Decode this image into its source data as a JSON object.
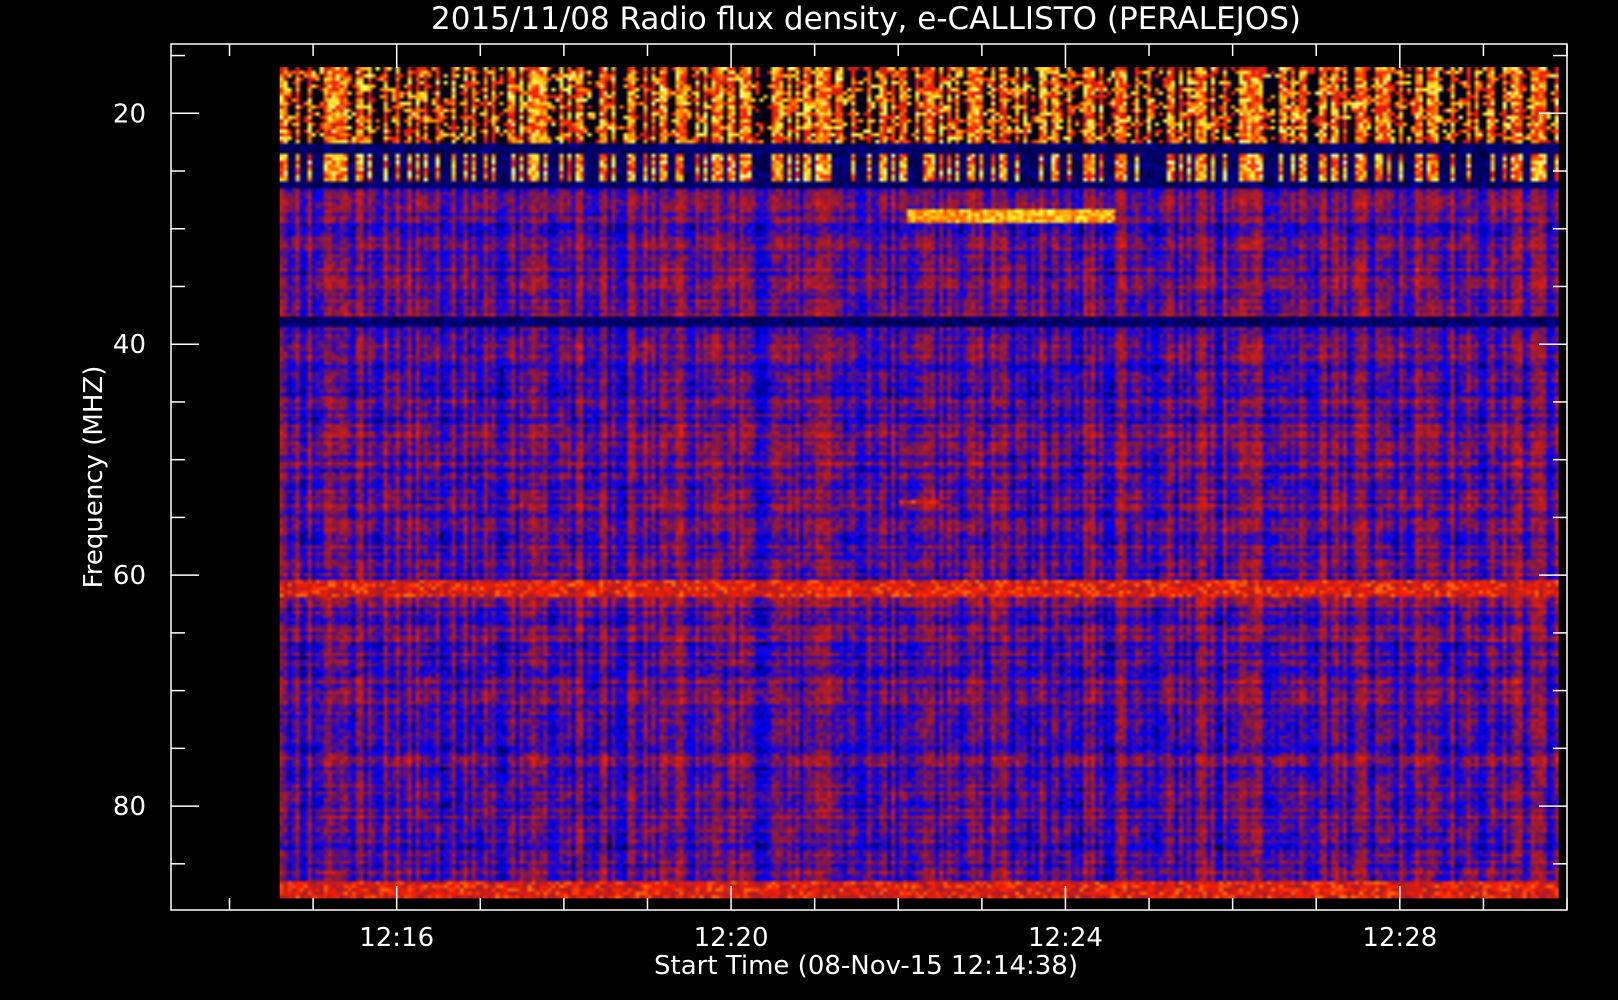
{
  "chart_data": {
    "type": "heatmap",
    "title": "2015/11/08  Radio flux density, e-CALLISTO (PERALEJOS)",
    "xlabel": "Start Time (08-Nov-15 12:14:38)",
    "ylabel": "Frequency (MHZ)",
    "x_ticks": [
      "12:16",
      "12:20",
      "12:24",
      "12:28"
    ],
    "x_tick_values_min": [
      16,
      20,
      24,
      28
    ],
    "x_range_min": [
      13.3,
      30.0
    ],
    "data_time_range_min": [
      14.6,
      29.9
    ],
    "y_ticks": [
      20,
      40,
      60,
      80
    ],
    "y_range_mhz": [
      14,
      89
    ],
    "data_freq_range_mhz": [
      16,
      88
    ],
    "colors": {
      "background": "#000000",
      "axes": "#ffffff",
      "colormap": [
        "#000000",
        "#0000ff",
        "#8b1a3a",
        "#ff2000",
        "#ffa000",
        "#ffff40",
        "#ffffff"
      ]
    },
    "features": [
      {
        "type": "band",
        "freq_mhz": [
          16,
          22.5
        ],
        "level": "strong"
      },
      {
        "type": "band",
        "freq_mhz": [
          22.5,
          26.5
        ],
        "level": "dark"
      },
      {
        "type": "band",
        "freq_mhz": [
          23.5,
          25.8
        ],
        "level": "bright_streaks"
      },
      {
        "type": "burst",
        "time_min": [
          22.1,
          24.6
        ],
        "freq_mhz": [
          28.4,
          29.4
        ],
        "level": "bright"
      },
      {
        "type": "band",
        "freq_mhz": [
          37.5,
          38.5
        ],
        "level": "dark"
      },
      {
        "type": "burst",
        "time_min": [
          22.0,
          22.5
        ],
        "freq_mhz": [
          53.4,
          53.9
        ],
        "level": "moderate"
      },
      {
        "type": "band",
        "freq_mhz": [
          60.5,
          62.0
        ],
        "level": "moderate"
      },
      {
        "type": "band",
        "freq_mhz": [
          86.5,
          88
        ],
        "level": "moderate"
      }
    ]
  }
}
